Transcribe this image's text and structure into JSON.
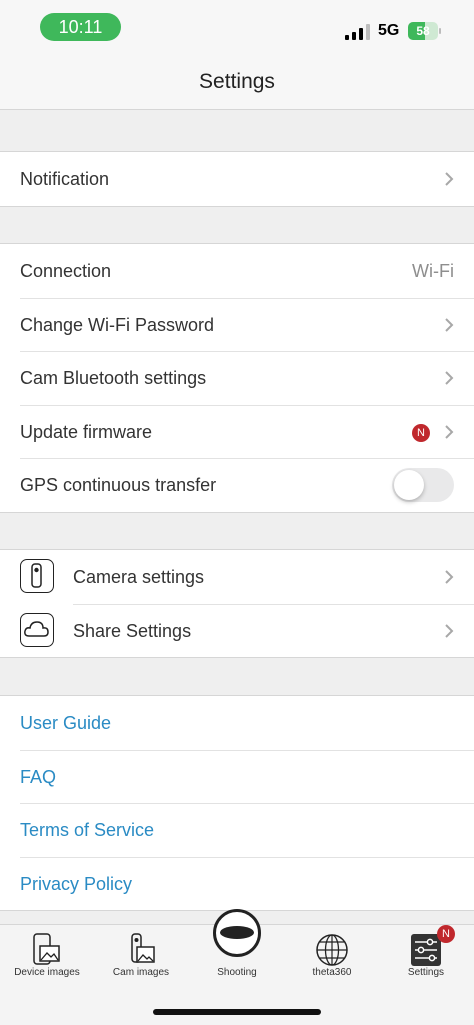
{
  "status_bar": {
    "time": "10:11",
    "network": "5G",
    "battery": "58",
    "battery_level_percent": 58
  },
  "header": {
    "title": "Settings"
  },
  "groups": {
    "notification": {
      "items": [
        {
          "label": "Notification"
        }
      ]
    },
    "connection": {
      "items": [
        {
          "label": "Connection",
          "value": "Wi-Fi"
        },
        {
          "label": "Change Wi-Fi Password"
        },
        {
          "label": "Cam Bluetooth settings"
        },
        {
          "label": "Update firmware",
          "badge": "N"
        },
        {
          "label": "GPS continuous transfer",
          "toggle_on": false
        }
      ]
    },
    "camera": {
      "items": [
        {
          "label": "Camera settings",
          "icon": "camera-icon"
        },
        {
          "label": "Share Settings",
          "icon": "cloud-icon"
        }
      ]
    },
    "links": {
      "items": [
        {
          "label": "User Guide"
        },
        {
          "label": "FAQ"
        },
        {
          "label": "Terms of Service"
        },
        {
          "label": "Privacy Policy"
        }
      ]
    }
  },
  "tab_bar": {
    "tabs": [
      {
        "label": "Device images",
        "icon": "device-images-icon"
      },
      {
        "label": "Cam images",
        "icon": "cam-images-icon"
      },
      {
        "label": "Shooting",
        "icon": "shutter-icon"
      },
      {
        "label": "theta360",
        "icon": "globe-icon"
      },
      {
        "label": "Settings",
        "icon": "settings-icon",
        "badge": "N",
        "selected": true
      }
    ]
  },
  "colors": {
    "accent_green": "#3fb85b",
    "link_blue": "#2a8bc4",
    "badge_red": "#c0282d",
    "background_gray": "#efefef"
  }
}
